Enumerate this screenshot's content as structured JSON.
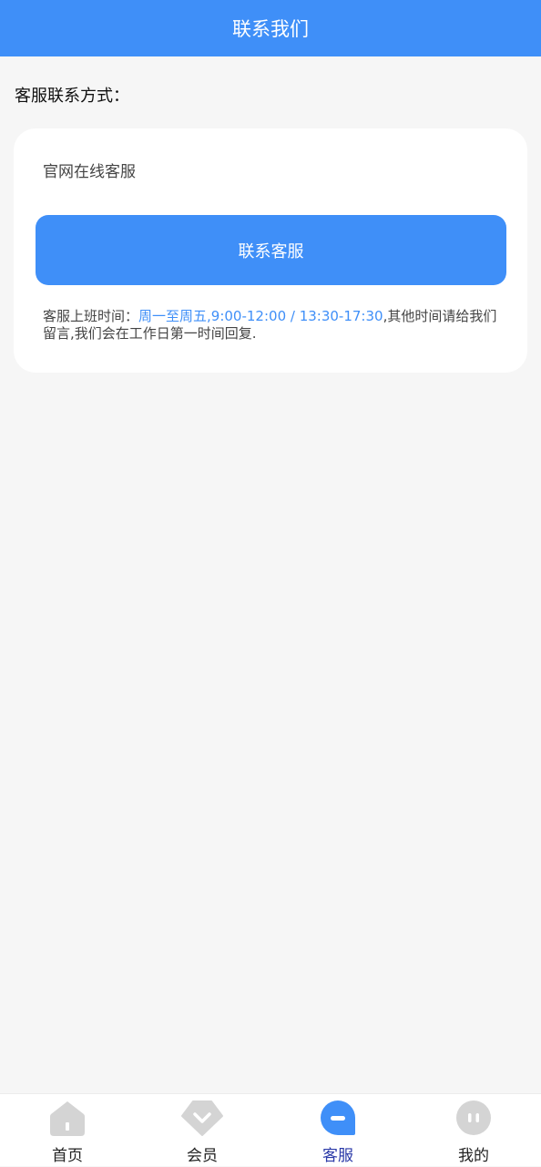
{
  "header": {
    "title": "联系我们"
  },
  "section": {
    "label": "客服联系方式："
  },
  "card": {
    "title": "官网在线客服",
    "button_label": "联系客服",
    "hours_prefix": "客服上班时间：",
    "hours_highlight": "周一至周五,9:00-12:00 / 13:30-17:30",
    "hours_suffix": ",其他时间请给我们留言,我们会在工作日第一时间回复."
  },
  "tabs": [
    {
      "label": "首页",
      "icon": "home-icon",
      "active": false
    },
    {
      "label": "会员",
      "icon": "diamond-icon",
      "active": false
    },
    {
      "label": "客服",
      "icon": "chat-icon",
      "active": true
    },
    {
      "label": "我的",
      "icon": "face-icon",
      "active": false
    }
  ],
  "colors": {
    "primary": "#3f8ff8",
    "active_tab_text": "#2b3aa8",
    "inactive_icon": "#d4d4d4",
    "background": "#f6f6f6"
  }
}
